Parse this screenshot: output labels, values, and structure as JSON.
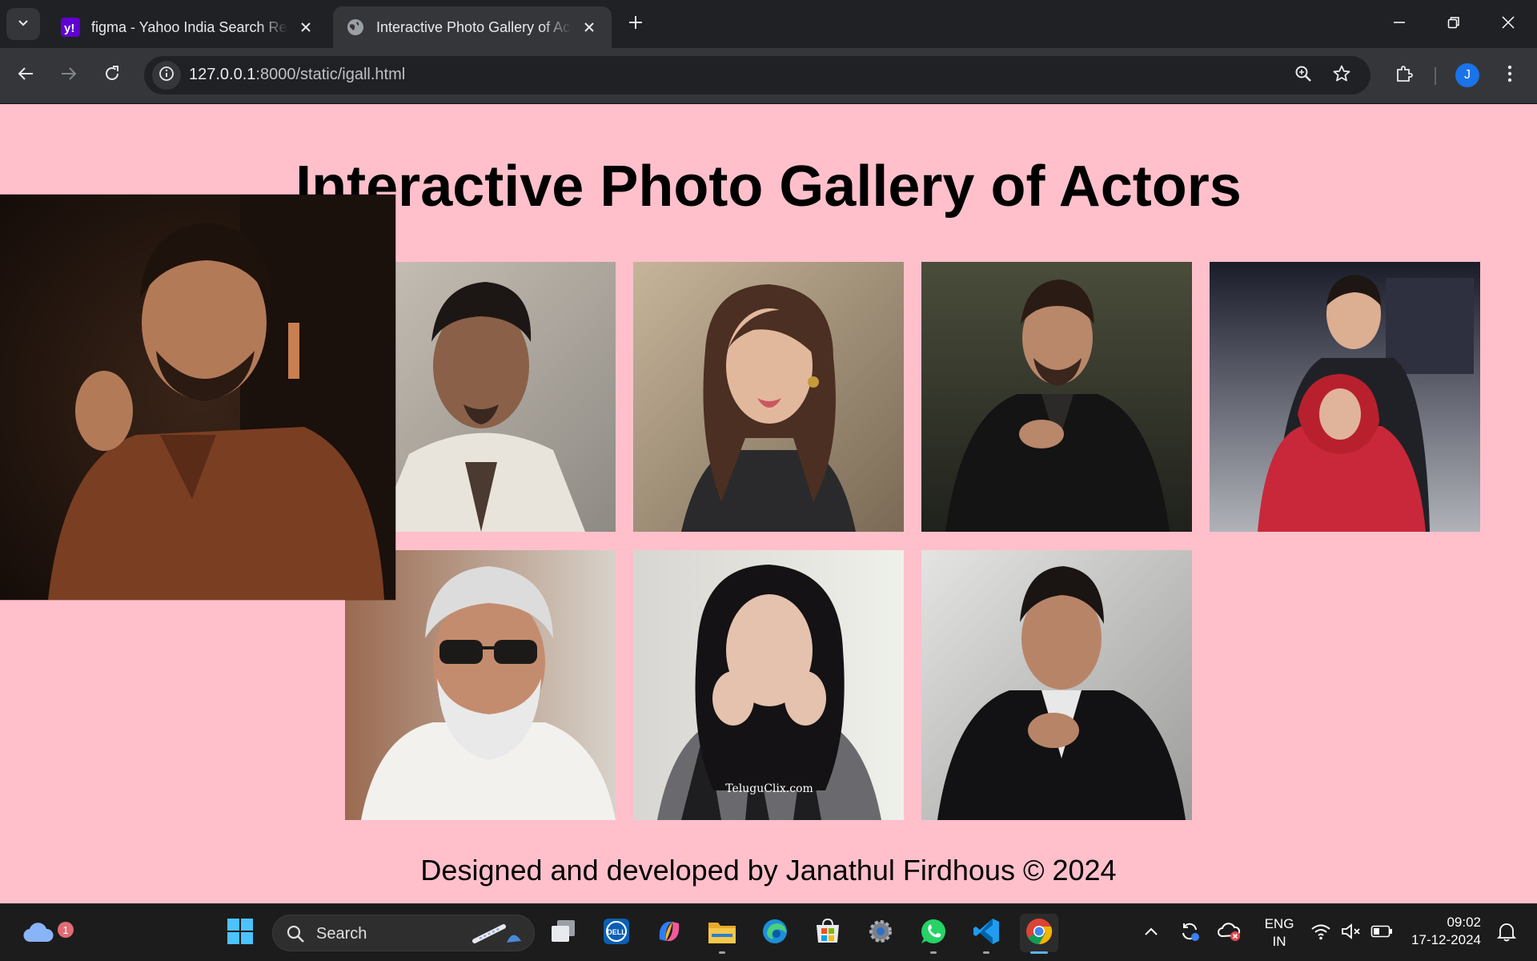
{
  "browser": {
    "tabs": [
      {
        "title": "figma - Yahoo India Search Results",
        "favicon": "yahoo-icon",
        "active": false
      },
      {
        "title": "Interactive Photo Gallery of Actors",
        "favicon": "globe-icon",
        "active": true
      }
    ],
    "url_host": "127.0.0.1",
    "url_path": ":8000/static/igall.html",
    "profile_initial": "J"
  },
  "page": {
    "title": "Interactive Photo Gallery of Actors",
    "footer": "Designed and developed by Janathul Firdhous © 2024",
    "background": "#ffc0cb",
    "photos": [
      {
        "name": "photo-1",
        "state": "hovered-enlarged"
      },
      {
        "name": "photo-2"
      },
      {
        "name": "photo-3"
      },
      {
        "name": "photo-4"
      },
      {
        "name": "photo-5"
      },
      {
        "name": "photo-6"
      },
      {
        "name": "photo-7"
      },
      {
        "name": "photo-8"
      }
    ],
    "photo_watermark": "TeluguClix.com"
  },
  "taskbar": {
    "weather_badge": "1",
    "search_label": "Search",
    "apps": [
      "start-icon",
      "search",
      "task-view-icon",
      "dell-icon",
      "copilot-icon",
      "file-explorer-icon",
      "edge-icon",
      "store-icon",
      "settings-icon",
      "whatsapp-icon",
      "vscode-icon",
      "chrome-icon"
    ],
    "language_line1": "ENG",
    "language_line2": "IN",
    "time": "09:02",
    "date": "17-12-2024"
  }
}
